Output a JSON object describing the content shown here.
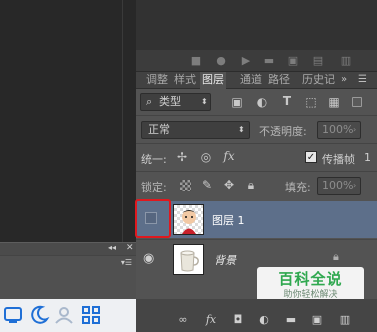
{
  "tabs": [
    {
      "label": "调整"
    },
    {
      "label": "样式"
    },
    {
      "label": "图层"
    },
    {
      "label": "通道"
    },
    {
      "label": "路径"
    },
    {
      "label": "历史记"
    }
  ],
  "filter": {
    "kind_label": "类型"
  },
  "blend": {
    "mode": "正常",
    "opacity_label": "不透明度:",
    "opacity_value": "100%"
  },
  "unify": {
    "label": "统一:",
    "propagate_label": "传播帧",
    "frame": "1"
  },
  "lock": {
    "label": "锁定:",
    "fill_label": "填充:",
    "fill_value": "100%"
  },
  "layers": [
    {
      "name": "图层 1",
      "selected": true
    },
    {
      "name": "背景",
      "locked": true
    }
  ],
  "watermark": {
    "title": "百科全说",
    "subtitle": "助你轻松解决"
  },
  "colors": {
    "selected_row": "#5d6f8a",
    "highlight_box": "#e0181e",
    "accent_taskbar": "#1f6fd6"
  }
}
